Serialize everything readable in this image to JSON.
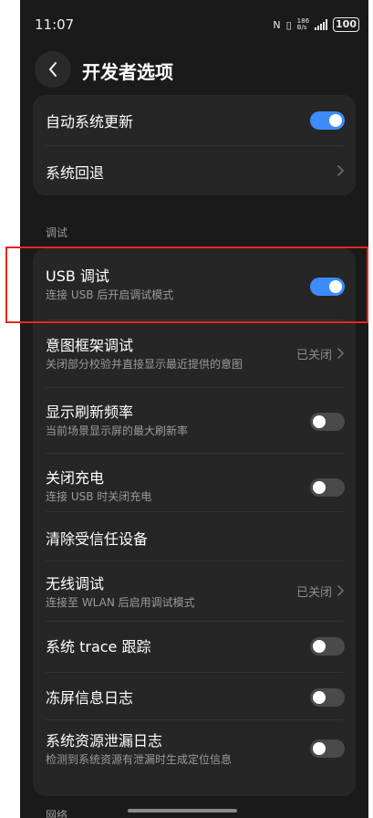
{
  "status_bar": {
    "time": "11:07",
    "icons": [
      "nfc-icon",
      "vibrate-icon",
      "network-speed-icon",
      "signal-icon",
      "battery-icon"
    ],
    "nfc": "N",
    "vibrate": "▯",
    "net_speed_value": "186",
    "net_speed_unit": "B/s",
    "battery": "100"
  },
  "header": {
    "title": "开发者选项"
  },
  "top_card": {
    "items": [
      {
        "title": "自动系统更新",
        "control": "toggle",
        "on": true
      },
      {
        "title": "系统回退",
        "control": "chevron"
      }
    ]
  },
  "sections": {
    "debug_label": "调试",
    "network_label": "网络"
  },
  "debug_card": {
    "items": [
      {
        "title": "USB 调试",
        "subtitle": "连接 USB 后开启调试模式",
        "control": "toggle",
        "on": true,
        "highlighted": true
      },
      {
        "title": "意图框架调试",
        "subtitle": "关闭部分校验并直接显示最近提供的意图",
        "value": "已关闭",
        "control": "chevron"
      },
      {
        "title": "显示刷新频率",
        "subtitle": "当前场景显示屏的最大刷新率",
        "control": "toggle",
        "on": false
      },
      {
        "title": "关闭充电",
        "subtitle": "连接 USB 时关闭充电",
        "control": "toggle",
        "on": false
      },
      {
        "title": "清除受信任设备",
        "control": "none"
      },
      {
        "title": "无线调试",
        "subtitle": "连接至 WLAN 后启用调试模式",
        "value": "已关闭",
        "control": "chevron"
      },
      {
        "title": "系统 trace 跟踪",
        "control": "toggle",
        "on": false
      },
      {
        "title": "冻屏信息日志",
        "control": "toggle",
        "on": false
      },
      {
        "title": "系统资源泄漏日志",
        "subtitle": "检测到系统资源有泄漏时生成定位信息",
        "control": "toggle",
        "on": false
      }
    ]
  },
  "colors": {
    "background": "#1a1a1a",
    "card": "#262626",
    "accent": "#3d8bfd",
    "highlight": "#e8261f"
  }
}
